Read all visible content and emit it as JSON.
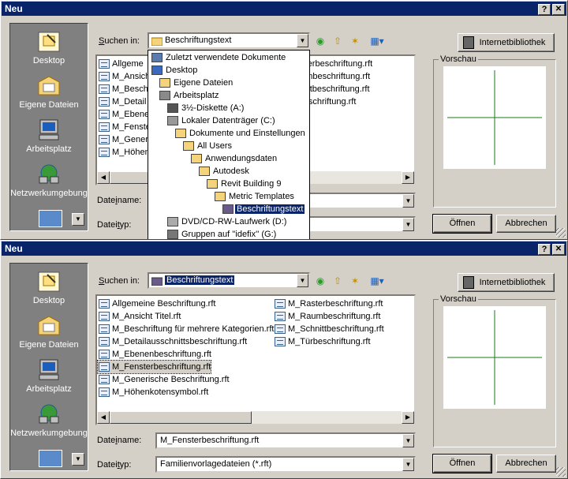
{
  "dialog_title": "Neu",
  "title_buttons": {
    "help": "?",
    "close": "✕"
  },
  "places": [
    {
      "label": "Desktop",
      "icon": "desktop-icon"
    },
    {
      "label": "Eigene Dateien",
      "icon": "my-documents-icon"
    },
    {
      "label": "Arbeitsplatz",
      "icon": "my-computer-icon"
    },
    {
      "label": "Netzwerkumgebung",
      "icon": "network-icon"
    }
  ],
  "look_in_label_prefix": "",
  "look_in_label_u": "S",
  "look_in_label_rest": "uchen in:",
  "look_in_value": "Beschriftungstext",
  "internet_button": "Internetbibliothek",
  "preview_label": "Vorschau",
  "filename_label_pre": "Date",
  "filename_label_u": "i",
  "filename_label_post": "name:",
  "filetype_label_pre": "Datei",
  "filetype_label_u": "t",
  "filetype_label_post": "yp:",
  "open_button": "Öffnen",
  "cancel_button": "Abbrechen",
  "top": {
    "files": [
      "Allgeme",
      "M_Ansich",
      "M_Besch",
      "M_Detail",
      "M_Ebene",
      "M_Fenste",
      "M_Generi",
      "M_Höhen"
    ],
    "files_right": [
      "asterbeschriftung.rft",
      "aumbeschriftung.rft",
      "hnittbeschriftung.rft",
      "rbeschriftung.rft"
    ],
    "dropdown": [
      {
        "label": "Zuletzt verwendete Dokumente",
        "indent": 0,
        "icon": "recent-icon"
      },
      {
        "label": "Desktop",
        "indent": 0,
        "icon": "desktop-icon"
      },
      {
        "label": "Eigene Dateien",
        "indent": 1,
        "icon": "folder-icon"
      },
      {
        "label": "Arbeitsplatz",
        "indent": 1,
        "icon": "my-computer-icon"
      },
      {
        "label": "3½-Diskette (A:)",
        "indent": 2,
        "icon": "floppy-icon"
      },
      {
        "label": "Lokaler Datenträger (C:)",
        "indent": 2,
        "icon": "drive-icon"
      },
      {
        "label": "Dokumente und Einstellungen",
        "indent": 3,
        "icon": "folder-icon"
      },
      {
        "label": "All Users",
        "indent": 4,
        "icon": "folder-icon"
      },
      {
        "label": "Anwendungsdaten",
        "indent": 5,
        "icon": "folder-icon"
      },
      {
        "label": "Autodesk",
        "indent": 6,
        "icon": "folder-icon"
      },
      {
        "label": "Revit Building 9",
        "indent": 7,
        "icon": "folder-icon"
      },
      {
        "label": "Metric Templates",
        "indent": 8,
        "icon": "folder-icon"
      },
      {
        "label": "Beschriftungstext",
        "indent": 9,
        "icon": "folder-open-icon",
        "selected": true
      },
      {
        "label": "DVD/CD-RW-Laufwerk (D:)",
        "indent": 2,
        "icon": "cd-drive-icon"
      },
      {
        "label": "Gruppen auf ''idefix'' (G:)",
        "indent": 2,
        "icon": "network-drive-icon"
      }
    ]
  },
  "bottom": {
    "files_left": [
      "Allgemeine Beschriftung.rft",
      "M_Ansicht Titel.rft",
      "M_Beschriftung für mehrere Kategorien.rft",
      "M_Detailausschnittsbeschriftung.rft",
      "M_Ebenenbeschriftung.rft",
      "M_Fensterbeschriftung.rft",
      "M_Generische Beschriftung.rft",
      "M_Höhenkotensymbol.rft"
    ],
    "files_right": [
      "M_Rasterbeschriftung.rft",
      "M_Raumbeschriftung.rft",
      "M_Schnittbeschriftung.rft",
      "M_Türbeschriftung.rft"
    ],
    "filename_value": "M_Fensterbeschriftung.rft",
    "filetype_value": "Familienvorlagedateien (*.rft)"
  },
  "colors": {
    "titlebar": "#0a246a",
    "preview_line": "#1a7a1a",
    "window": "#d4d0c8"
  }
}
